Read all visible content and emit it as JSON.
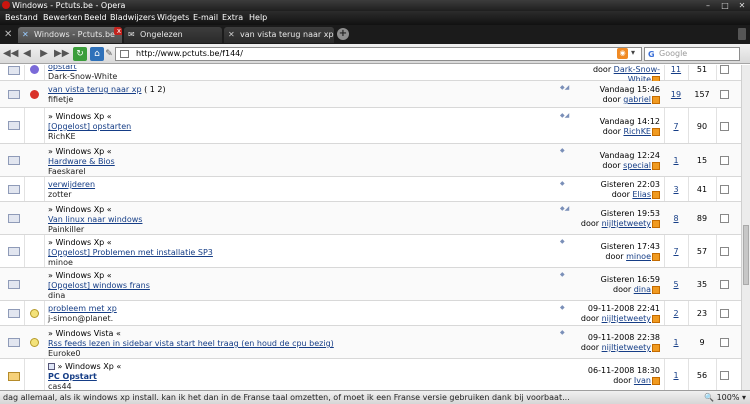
{
  "window": {
    "title": "Windows - Pctuts.be - Opera"
  },
  "menu": [
    "Bestand",
    "Bewerken",
    "Beeld",
    "Bladwijzers",
    "Widgets",
    "E-mail",
    "Extra",
    "Help"
  ],
  "tabs": [
    {
      "label": "Windows - Pctuts.be",
      "active": true
    },
    {
      "label": "Ongelezen",
      "active": false
    },
    {
      "label": "van vista terug naar xp...",
      "active": false
    }
  ],
  "address": {
    "url": "http://www.pctuts.be/f144/"
  },
  "search": {
    "placeholder": "Google"
  },
  "threads": [
    {
      "prefix": "",
      "title": "opstart",
      "starter": "Dark-Snow-White",
      "last_date": "",
      "last_user": "Dark-Snow-White",
      "replies": "11",
      "views": "51",
      "emote": "smiley"
    },
    {
      "prefix": "",
      "title": "van vista terug naar xp",
      "pages": "( 1 2)",
      "starter": "fifietje",
      "last_date": "Vandaag 15:46",
      "last_user": "gabriel",
      "replies": "19",
      "views": "157",
      "emote": "red"
    },
    {
      "prefix": "» Windows Xp «",
      "title": "[Opgelost] opstarten",
      "starter": "RichKE",
      "last_date": "Vandaag 14:12",
      "last_user": "RichKE",
      "replies": "7",
      "views": "90",
      "emote": ""
    },
    {
      "prefix": "» Windows Xp «",
      "title": "Hardware & Bios",
      "starter": "Faeskarel",
      "last_date": "Vandaag 12:24",
      "last_user": "special",
      "replies": "1",
      "views": "15",
      "emote": ""
    },
    {
      "prefix": "",
      "title": "verwijderen",
      "starter": "zotter",
      "last_date": "Gisteren 22:03",
      "last_user": "Elias",
      "replies": "3",
      "views": "41",
      "emote": ""
    },
    {
      "prefix": "» Windows Xp «",
      "title": "Van linux naar windows",
      "starter": "Painkiller",
      "last_date": "Gisteren 19:53",
      "last_user": "nijltjetweety",
      "replies": "8",
      "views": "89",
      "emote": ""
    },
    {
      "prefix": "» Windows Xp «",
      "title": "[Opgelost] Problemen met installatie SP3",
      "starter": "minoe",
      "last_date": "Gisteren 17:43",
      "last_user": "minoe",
      "replies": "7",
      "views": "57",
      "emote": ""
    },
    {
      "prefix": "» Windows Xp «",
      "title": "[Opgelost] windows frans",
      "starter": "dina",
      "last_date": "Gisteren 16:59",
      "last_user": "dina",
      "replies": "5",
      "views": "35",
      "emote": ""
    },
    {
      "prefix": "",
      "title": "probleem met xp",
      "starter": "j-simon@planet.",
      "last_date": "09-11-2008 22:41",
      "last_user": "nijltjetweety",
      "replies": "2",
      "views": "23",
      "emote": "bulb"
    },
    {
      "prefix": "» Windows Vista «",
      "title": "Rss feeds lezen in sidebar vista start heel traag (en houd de cpu bezig)",
      "starter": "Euroke0",
      "last_date": "09-11-2008 22:38",
      "last_user": "nijltjetweety",
      "replies": "1",
      "views": "9",
      "emote": "bulb"
    },
    {
      "prefix": "» Windows Xp «",
      "title": "PC Opstart",
      "starter": "cas44",
      "last_date": "06-11-2008 18:30",
      "last_user": "Ivan",
      "replies": "1",
      "views": "56",
      "emote": ""
    }
  ],
  "labels": {
    "by": "door"
  },
  "status": {
    "text": "dag allemaal,    als ik windows xp install. kan ik het dan in de Franse taal omzetten, of moet ik een Franse versie gebruiken    dank bij voorbaat...",
    "zoom": "100%"
  }
}
